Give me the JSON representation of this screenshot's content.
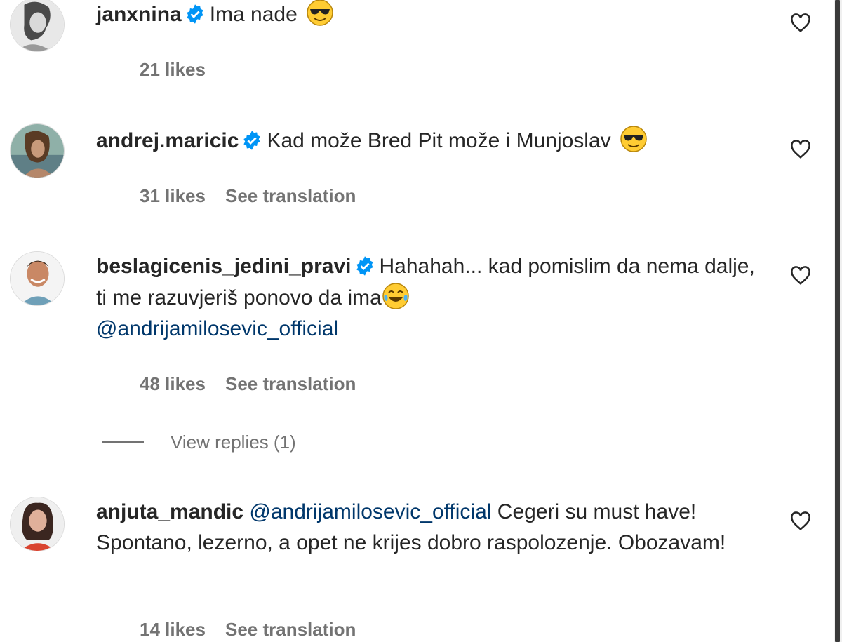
{
  "comments": [
    {
      "username": "janxnina",
      "verified": true,
      "text": "Ima nade",
      "emoji": "sunglasses-emoji",
      "likes": "21 likes",
      "translate": ""
    },
    {
      "username": "andrej.maricic",
      "verified": true,
      "text": "Kad može Bred Pit može i Munjoslav",
      "emoji": "sunglasses-emoji",
      "likes": "31 likes",
      "translate": "See translation"
    },
    {
      "username": "beslagicenis_jedini_pravi",
      "verified": true,
      "text": "Hahahah... kad pomislim da nema dalje, ti me razuvjeriš ponovo da ima",
      "emoji": "laughing-tears-emoji",
      "mention": "@andrijamilosevic_official",
      "likes": "48 likes",
      "translate": "See translation",
      "view_replies": "View replies (1)"
    },
    {
      "username": "anjuta_mandic",
      "verified": false,
      "mention": "@andrijamilosevic_official",
      "text": "Cegeri su must have! Spontano, lezerno, a opet ne krijes dobro raspolozenje. Obozavam!",
      "likes": "14 likes",
      "translate": "See translation"
    }
  ],
  "colors": {
    "text": "#262626",
    "secondary": "#737373",
    "mention": "#00376b",
    "verified": "#0095f6"
  },
  "icons": [
    "heart-outline-icon",
    "verified-badge-icon"
  ]
}
